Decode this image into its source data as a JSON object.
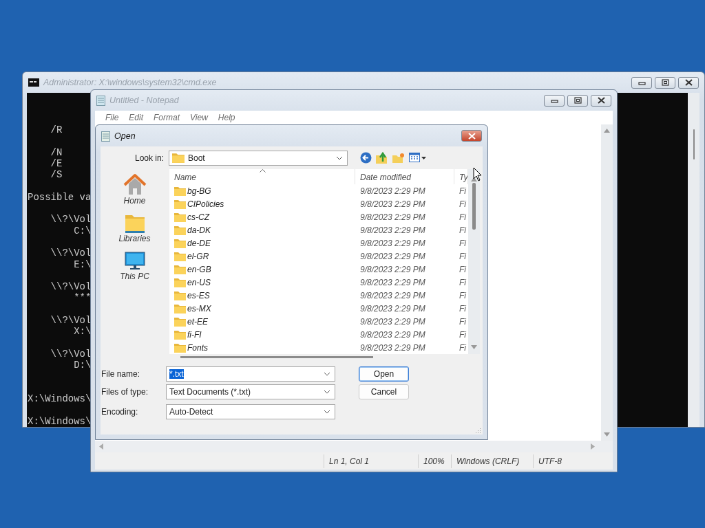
{
  "cmd_window": {
    "title": "Administrator: X:\\windows\\system32\\cmd.exe",
    "active": false,
    "console": {
      "blocks": [
        [
          "    /R"
        ],
        [
          "    /N",
          "    /E",
          "    /S"
        ],
        [
          "Possible va"
        ],
        [
          "    \\\\?\\Vol",
          "        C:\\"
        ],
        [
          "    \\\\?\\Vol",
          "        E:\\"
        ],
        [
          "    \\\\?\\Vol",
          "        ***"
        ],
        [
          "    \\\\?\\Vol",
          "        X:\\"
        ],
        [
          "    \\\\?\\Vol",
          "        D:\\"
        ]
      ],
      "prompts": [
        "X:\\Windows\\",
        "X:\\Windows\\"
      ]
    }
  },
  "notepad_window": {
    "title": "Untitled - Notepad",
    "active": false,
    "menu": [
      "File",
      "Edit",
      "Format",
      "View",
      "Help"
    ],
    "status_bar": [
      "Ln 1, Col 1",
      "100%",
      "Windows (CRLF)",
      "UTF-8"
    ]
  },
  "open_dialog": {
    "title": "Open",
    "active": true,
    "look_in": {
      "label": "Look in:",
      "value": "Boot"
    },
    "places": [
      {
        "kind": "home",
        "label": "Home"
      },
      {
        "kind": "libraries",
        "label": "Libraries"
      },
      {
        "kind": "pc",
        "label": "This PC"
      }
    ],
    "columns": [
      "Name",
      "Date modified",
      "Ty"
    ],
    "rows": [
      {
        "name": "bg-BG",
        "date": "9/8/2023 2:29 PM",
        "type": "Fi"
      },
      {
        "name": "CIPolicies",
        "date": "9/8/2023 2:29 PM",
        "type": "Fi"
      },
      {
        "name": "cs-CZ",
        "date": "9/8/2023 2:29 PM",
        "type": "Fi"
      },
      {
        "name": "da-DK",
        "date": "9/8/2023 2:29 PM",
        "type": "Fi"
      },
      {
        "name": "de-DE",
        "date": "9/8/2023 2:29 PM",
        "type": "Fi"
      },
      {
        "name": "el-GR",
        "date": "9/8/2023 2:29 PM",
        "type": "Fi"
      },
      {
        "name": "en-GB",
        "date": "9/8/2023 2:29 PM",
        "type": "Fi"
      },
      {
        "name": "en-US",
        "date": "9/8/2023 2:29 PM",
        "type": "Fi"
      },
      {
        "name": "es-ES",
        "date": "9/8/2023 2:29 PM",
        "type": "Fi"
      },
      {
        "name": "es-MX",
        "date": "9/8/2023 2:29 PM",
        "type": "Fi"
      },
      {
        "name": "et-EE",
        "date": "9/8/2023 2:29 PM",
        "type": "Fi"
      },
      {
        "name": "fi-FI",
        "date": "9/8/2023 2:29 PM",
        "type": "Fi"
      },
      {
        "name": "Fonts",
        "date": "9/8/2023 2:29 PM",
        "type": "Fi"
      }
    ],
    "fields": [
      {
        "label": "File name:",
        "value": "*.txt",
        "selected_text": true
      },
      {
        "label": "Files of type:",
        "value": "Text Documents (*.txt)",
        "selected_text": false
      },
      {
        "label": "Encoding:",
        "value": "Auto-Detect",
        "selected_text": false
      }
    ],
    "buttons": [
      {
        "label": "Open",
        "default": true
      },
      {
        "label": "Cancel",
        "default": false
      }
    ]
  }
}
